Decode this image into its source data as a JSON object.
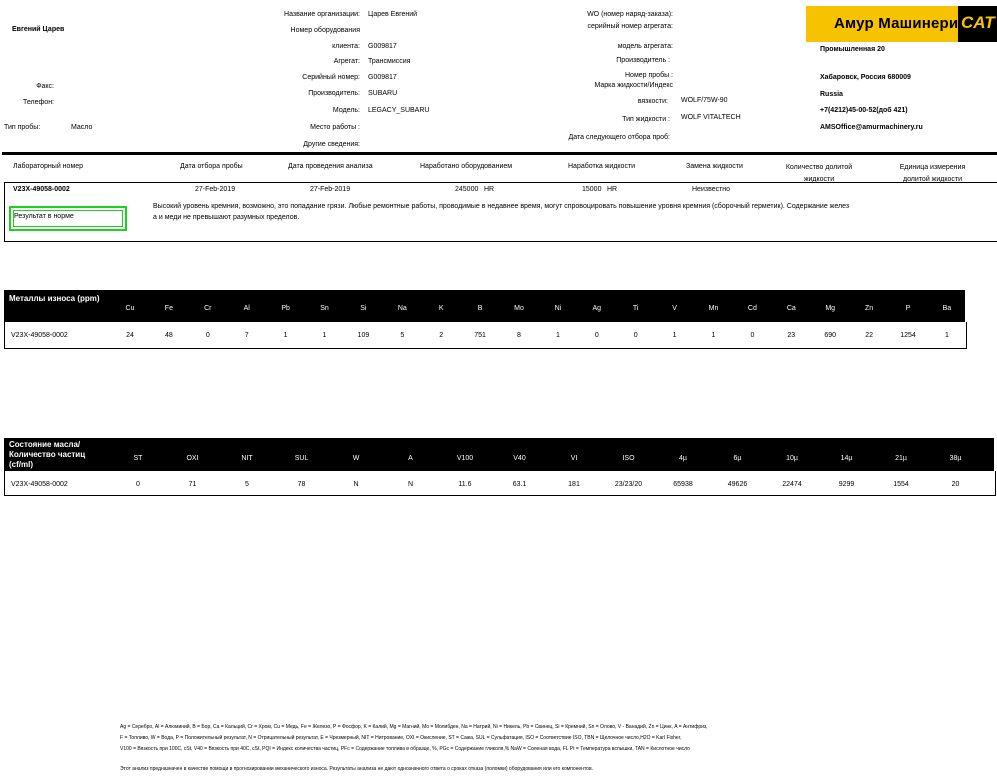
{
  "customer": {
    "name": "Евгений Царев",
    "fax_label": "Факс:",
    "phone_label": "Телефон:",
    "sample_type_label": "Тип пробы:",
    "sample_type_value": "Масло"
  },
  "org": {
    "org_name_label": "Название организации:",
    "org_name_value": "Царев Евгений",
    "equip_number_label": "Номер оборудования",
    "client_label": "клиента:",
    "client_value": "G009817",
    "unit_label": "Агрегат:",
    "unit_value": "Трансмиссия",
    "serial_label": "Серийный номер:",
    "serial_value": "G009817",
    "manufacturer_label": "Производитель:",
    "manufacturer_value": "SUBARU",
    "model_label": "Модель:",
    "model_value": "LEGACY_SUBARU",
    "workplace_label": "Место работы :",
    "other_label": "Другие сведения:"
  },
  "wo": {
    "wo_label": "WO (номер наряд-заказа):",
    "unit_serial_label": "серийный номер агрегата:",
    "unit_model_label": "модель агрегата:",
    "unit_manufacturer_label": "Производитель :",
    "sample_number_label": "Номер пробы :",
    "fluid_brand_label": "Марка жидкости/Индекс",
    "viscosity_label": "вязкости:",
    "viscosity_value": "WOLF/75W-90",
    "fluid_type_label": "Тип жидкости :",
    "fluid_type_value": "WOLF VITALTECH",
    "next_sample_label": "Дата следующего отбора проб:"
  },
  "company": {
    "logo_text": "Амур Машинери",
    "logo_mark": "CAT",
    "address": "Промышленная 20",
    "city": "Хабаровск, Россия  680009",
    "country": "Russia",
    "phone": "+7(4212)45-00-52(доб 421)",
    "email": "AMSOffice@amurmachinery.ru"
  },
  "sample_header": {
    "lab_number": "Лабораторный номер",
    "sample_date": "Дата отбора пробы",
    "analysis_date": "Дата проведения анализа",
    "equip_hours": "Наработано оборудованием",
    "fluid_hours": "Наработка жидкости",
    "fluid_change": "Замена жидкости",
    "fluid_qty": "Количество долитой жидкости",
    "fluid_unit": "Единица измерения долитой жидкости"
  },
  "sample_row": {
    "lab_number": "V23X-49058-0002",
    "sample_date": "27-Feb-2019",
    "analysis_date": "27-Feb-2019",
    "equip_hours": "245000",
    "equip_hours_unit": "HR",
    "fluid_hours": "15000",
    "fluid_hours_unit": "HR",
    "fluid_change": "Неизвестно",
    "result": "Результат в норме",
    "comment_line1": "Высокий уровень кремния, возможно, это попадание грязи.  Любые ремонтные работы, проводимые в недавнее время, могут спровоцировать повышение уровня кремния (сборочный герметик).  Содержание желез",
    "comment_line2": "а и меди не превышают разумных пределов.",
    "status_color": "#1fd11f"
  },
  "metals": {
    "title": "Металлы износа (ppm)",
    "columns": [
      "Cu",
      "Fe",
      "Cr",
      "Al",
      "Pb",
      "Sn",
      "Si",
      "Na",
      "K",
      "B",
      "Mo",
      "Ni",
      "Ag",
      "Ti",
      "V",
      "Mn",
      "Cd",
      "Ca",
      "Mg",
      "Zn",
      "P",
      "Ba"
    ],
    "row_label": "V23X-49058-0002",
    "values": [
      "24",
      "48",
      "0",
      "7",
      "1",
      "1",
      "109",
      "5",
      "2",
      "751",
      "8",
      "1",
      "0",
      "0",
      "1",
      "1",
      "0",
      "23",
      "690",
      "22",
      "1254",
      "1"
    ]
  },
  "condition": {
    "title": "Состояние масла/Количество частиц (cf/ml)",
    "columns": [
      "ST",
      "OXI",
      "NIT",
      "SUL",
      "W",
      "A",
      "V100",
      "V40",
      "VI",
      "ISO",
      "4µ",
      "6µ",
      "10µ",
      "14µ",
      "21µ",
      "38µ"
    ],
    "row_label": "V23X-49058-0002",
    "values": [
      "0",
      "71",
      "5",
      "78",
      "N",
      "N",
      "11.6",
      "63.1",
      "181",
      "23/23/20",
      "65938",
      "49626",
      "22474",
      "9299",
      "1554",
      "20"
    ]
  },
  "footer": {
    "legend1": "Ag = Серебро, Al = Алюминий, B = Бор, Ca = Кальций, Cr = Хром, Cu = Медь, Fe = Железо, P = Фосфор, K = Калий, Mg = Магний,  Mo = Молибден, Na = Натрий, Ni = Никель, Pb = Свинец, Si = Кремний, Sn = Олово, V - Ванадий, Zn = Цинк, A = Антифриз,",
    "legend2": "F = Топливо, W = Вода, P = Положительный результат, N = Отрицательный результат, E = Чрезмерный, NIT = Нитрование, OXI = Окисление, ST = Сажа, SUL = Сульфатация, ISO = Соответствие ISO, TBN = Щелочное число,H2O = Karl Fisher,",
    "legend3": "V100 = Вязкость при 100C, cSt, V40 = Вязкость при 40C, cSt, PQI = Индекс количества частиц, PFc = Содержание топлива в образце, %, PGc = Содержание гликоля,% NaW = Соленая вода, FL Pt = Температура вспышки, TAN = Кислотное число",
    "disclaimer": "Этот анализ предназначен в качестве помощи в прогнозировании механического износа. Результаты анализа не дают однозначного ответа о сроках отказа (поломки) оборудования или его компонентов."
  }
}
